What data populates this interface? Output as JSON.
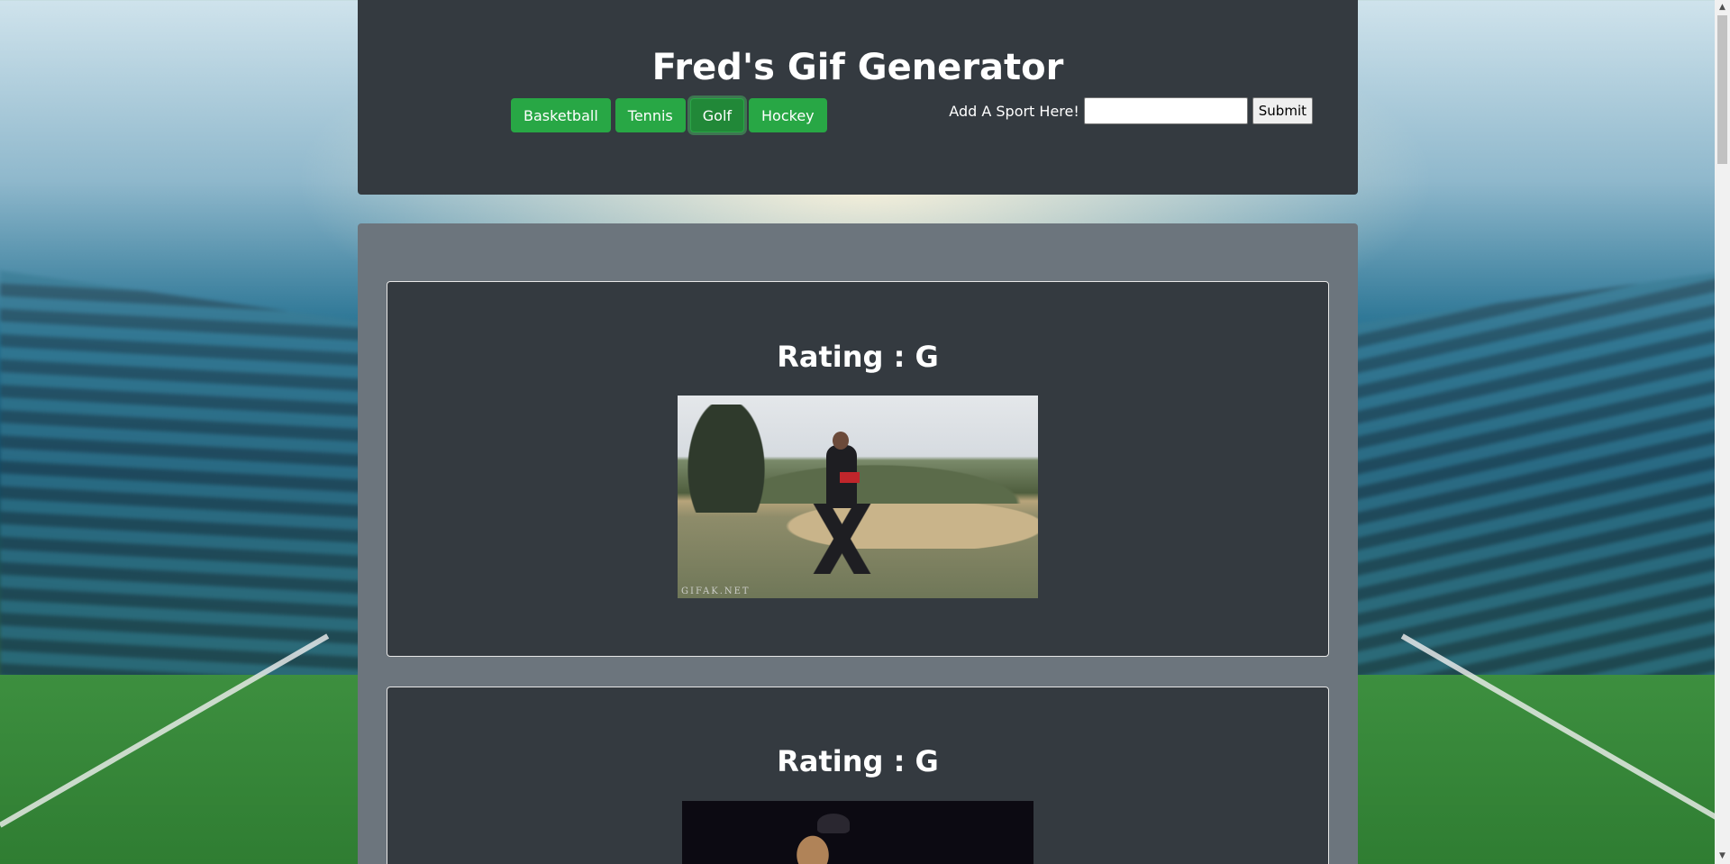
{
  "header": {
    "title": "Fred's Gif Generator",
    "sport_buttons": [
      {
        "label": "Basketball"
      },
      {
        "label": "Tennis"
      },
      {
        "label": "Golf"
      },
      {
        "label": "Hockey"
      }
    ],
    "active_button": "Golf",
    "add_label": "Add A Sport Here!",
    "add_input_value": "",
    "submit_label": "Submit"
  },
  "results": [
    {
      "rating": "Rating : G",
      "watermark": "GIFAK.NET"
    },
    {
      "rating": "Rating : G"
    }
  ],
  "colors": {
    "header_bg": "#343a40",
    "results_bg": "#6c757d",
    "button_green": "#28a745"
  },
  "icons": {
    "scroll_up": "triangle-up-icon",
    "scroll_down": "triangle-down-icon"
  }
}
